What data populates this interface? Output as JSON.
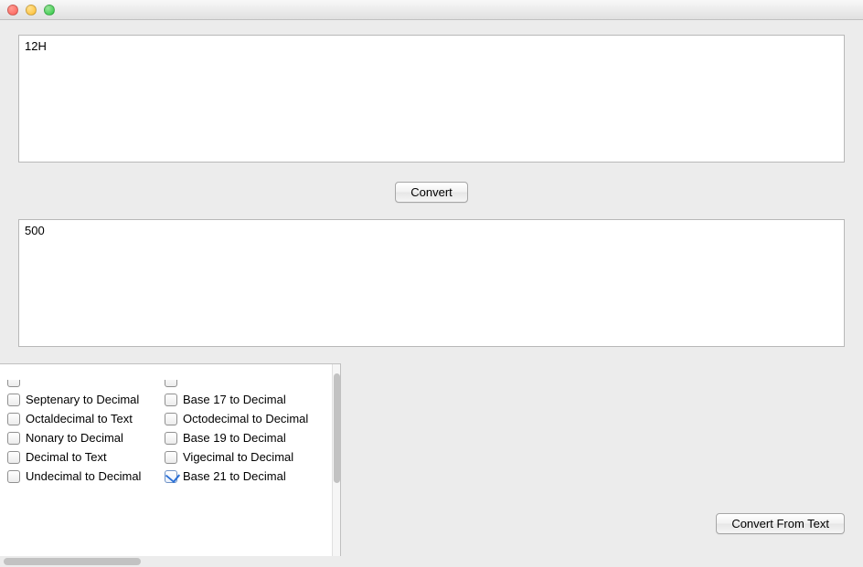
{
  "input_value": "12H",
  "output_value": "500",
  "buttons": {
    "convert": "Convert",
    "convert_from_text": "Convert From Text"
  },
  "options": {
    "col1": [
      {
        "label": "",
        "checked": false,
        "cutoff": true
      },
      {
        "label": "Septenary to Decimal",
        "checked": false
      },
      {
        "label": "Octaldecimal to Text",
        "checked": false
      },
      {
        "label": "Nonary to Decimal",
        "checked": false
      },
      {
        "label": "Decimal to Text",
        "checked": false
      },
      {
        "label": "Undecimal to Decimal",
        "checked": false
      }
    ],
    "col2": [
      {
        "label": "",
        "checked": false,
        "cutoff": true
      },
      {
        "label": "Base 17 to Decimal",
        "checked": false
      },
      {
        "label": "Octodecimal to Decimal",
        "checked": false
      },
      {
        "label": "Base 19 to Decimal",
        "checked": false
      },
      {
        "label": "Vigecimal to Decimal",
        "checked": false
      },
      {
        "label": "Base 21 to Decimal",
        "checked": true
      }
    ]
  }
}
